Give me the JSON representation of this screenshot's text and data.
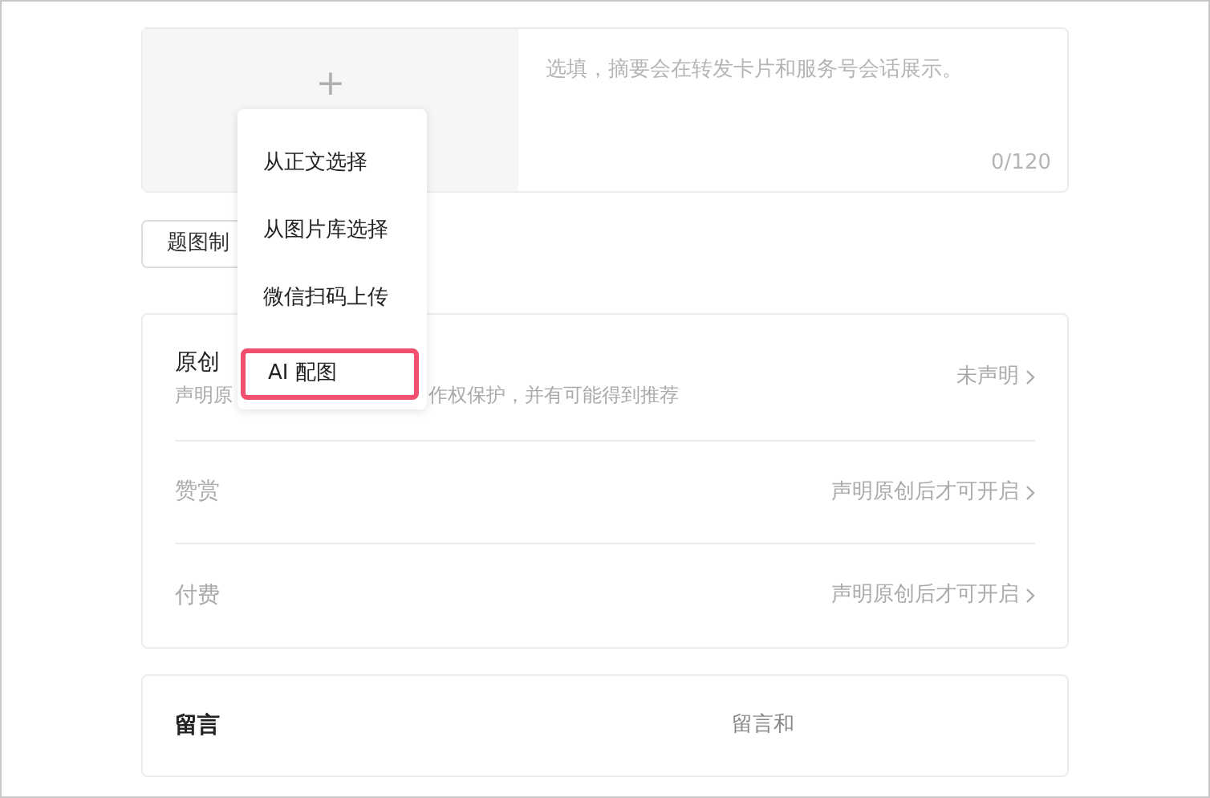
{
  "cover": {
    "summary_placeholder": "选填，摘要会在转发卡片和服务号会话展示。",
    "count": "0/120",
    "add_icon": "+"
  },
  "cover_button": {
    "label": "题图制"
  },
  "menu": {
    "items": [
      {
        "label": "从正文选择",
        "selected": false
      },
      {
        "label": "从图片库选择",
        "selected": false
      },
      {
        "label": "微信扫码上传",
        "selected": false
      },
      {
        "label": "AI 配图",
        "selected": true
      }
    ]
  },
  "settings": {
    "rows": [
      {
        "title": "原创",
        "subtitle_parts": [
          "声明原",
          "作权保护，并有可能得到推荐"
        ],
        "value": "未声明",
        "disabled": false
      },
      {
        "title": "赞赏",
        "value": "声明原创后才可开启",
        "disabled": true
      },
      {
        "title": "付费",
        "value": "声明原创后才可开启",
        "disabled": true
      }
    ]
  },
  "comments": {
    "title": "留言",
    "value": "留言和"
  }
}
